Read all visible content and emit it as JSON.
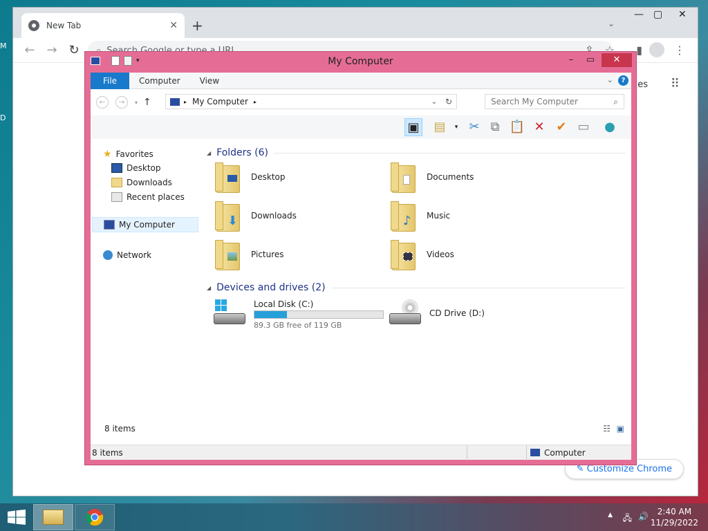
{
  "desktop": {
    "frag1": "M",
    "frag2": "D"
  },
  "chrome": {
    "tab_title": "New Tab",
    "omnibox_placeholder": "Search Google or type a URL",
    "apps_partial": "es",
    "customize": "Customize Chrome"
  },
  "explorer": {
    "title": "My Computer",
    "ribbon": {
      "file": "File",
      "tabs": [
        "Computer",
        "View"
      ]
    },
    "address": "My Computer",
    "search_placeholder": "Search My Computer",
    "nav": {
      "favorites": "Favorites",
      "fav_items": [
        "Desktop",
        "Downloads",
        "Recent places"
      ],
      "computer": "My Computer",
      "network": "Network"
    },
    "groups": {
      "folders": "Folders (6)",
      "devices": "Devices and drives (2)"
    },
    "folders": [
      {
        "name": "Desktop",
        "icon": "desktop-folder-icon"
      },
      {
        "name": "Documents",
        "icon": "documents-folder-icon"
      },
      {
        "name": "Downloads",
        "icon": "downloads-folder-icon"
      },
      {
        "name": "Music",
        "icon": "music-folder-icon"
      },
      {
        "name": "Pictures",
        "icon": "pictures-folder-icon"
      },
      {
        "name": "Videos",
        "icon": "videos-folder-icon"
      }
    ],
    "drives": [
      {
        "name": "Local Disk (C:)",
        "free": "89.3 GB free of 119 GB",
        "used_fraction": 0.25
      },
      {
        "name": "CD Drive (D:)"
      }
    ],
    "status_items": "8 items",
    "statusbar_items": "8 items",
    "statusbar_location": "Computer"
  },
  "taskbar": {
    "time": "2:40 AM",
    "date": "11/29/2022"
  },
  "colors": {
    "explorer_frame": "#e56d95",
    "accent": "#1979ca",
    "close": "#c7364d"
  }
}
